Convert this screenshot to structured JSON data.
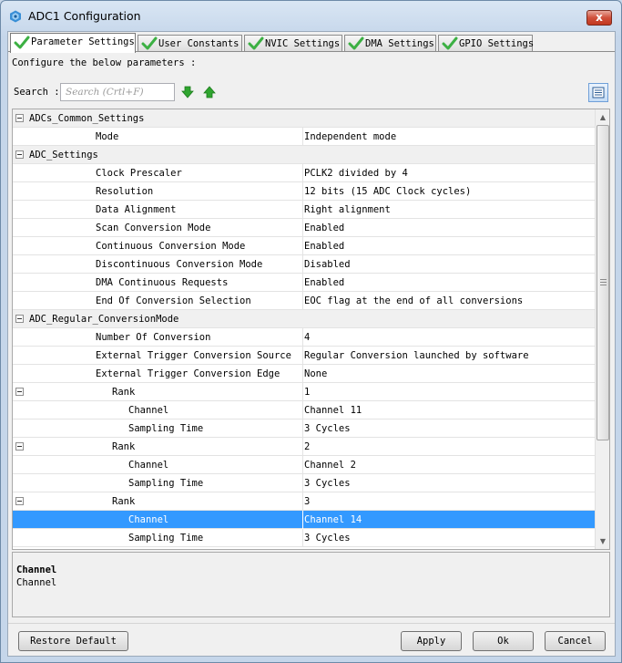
{
  "window": {
    "title": "ADC1 Configuration",
    "close_glyph": "x"
  },
  "tabs": [
    {
      "label": "Parameter Settings",
      "icon": "check-icon"
    },
    {
      "label": "User Constants",
      "icon": "check-icon"
    },
    {
      "label": "NVIC Settings",
      "icon": "check-icon"
    },
    {
      "label": "DMA Settings",
      "icon": "check-icon"
    },
    {
      "label": "GPIO Settings",
      "icon": "check-icon"
    }
  ],
  "instructions": "Configure the below parameters :",
  "search": {
    "label": "Search :",
    "placeholder": "Search (Crtl+F)"
  },
  "grid": {
    "rows": [
      {
        "label": "ADCs_Common_Settings",
        "value": ""
      },
      {
        "label": "Mode",
        "value": "Independent mode"
      },
      {
        "label": "ADC_Settings",
        "value": ""
      },
      {
        "label": "Clock Prescaler",
        "value": "PCLK2 divided by 4"
      },
      {
        "label": "Resolution",
        "value": "12 bits (15 ADC Clock cycles)"
      },
      {
        "label": "Data Alignment",
        "value": "Right alignment"
      },
      {
        "label": "Scan Conversion Mode",
        "value": "Enabled"
      },
      {
        "label": "Continuous Conversion Mode",
        "value": "Enabled"
      },
      {
        "label": "Discontinuous Conversion Mode",
        "value": "Disabled"
      },
      {
        "label": "DMA Continuous Requests",
        "value": "Enabled"
      },
      {
        "label": "End Of Conversion Selection",
        "value": "EOC flag at the end of all conversions"
      },
      {
        "label": "ADC_Regular_ConversionMode",
        "value": ""
      },
      {
        "label": "Number Of Conversion",
        "value": "4"
      },
      {
        "label": "External Trigger Conversion Source",
        "value": "Regular Conversion launched by software"
      },
      {
        "label": "External Trigger Conversion Edge",
        "value": "None"
      },
      {
        "label": "Rank",
        "value": "1"
      },
      {
        "label": "Channel",
        "value": "Channel 11"
      },
      {
        "label": "Sampling Time",
        "value": "3 Cycles"
      },
      {
        "label": "Rank",
        "value": "2"
      },
      {
        "label": "Channel",
        "value": "Channel 2"
      },
      {
        "label": "Sampling Time",
        "value": "3 Cycles"
      },
      {
        "label": "Rank",
        "value": "3"
      },
      {
        "label": "Channel",
        "value": "Channel 14"
      },
      {
        "label": "Sampling Time",
        "value": "3 Cycles"
      }
    ]
  },
  "description": {
    "title": "Channel",
    "text": "Channel"
  },
  "buttons": {
    "restore": "Restore Default",
    "apply": "Apply",
    "ok": "Ok",
    "cancel": "Cancel"
  },
  "colors": {
    "selection": "#3399ff",
    "check": "#3cb043",
    "arrow": "#2fa52f"
  }
}
